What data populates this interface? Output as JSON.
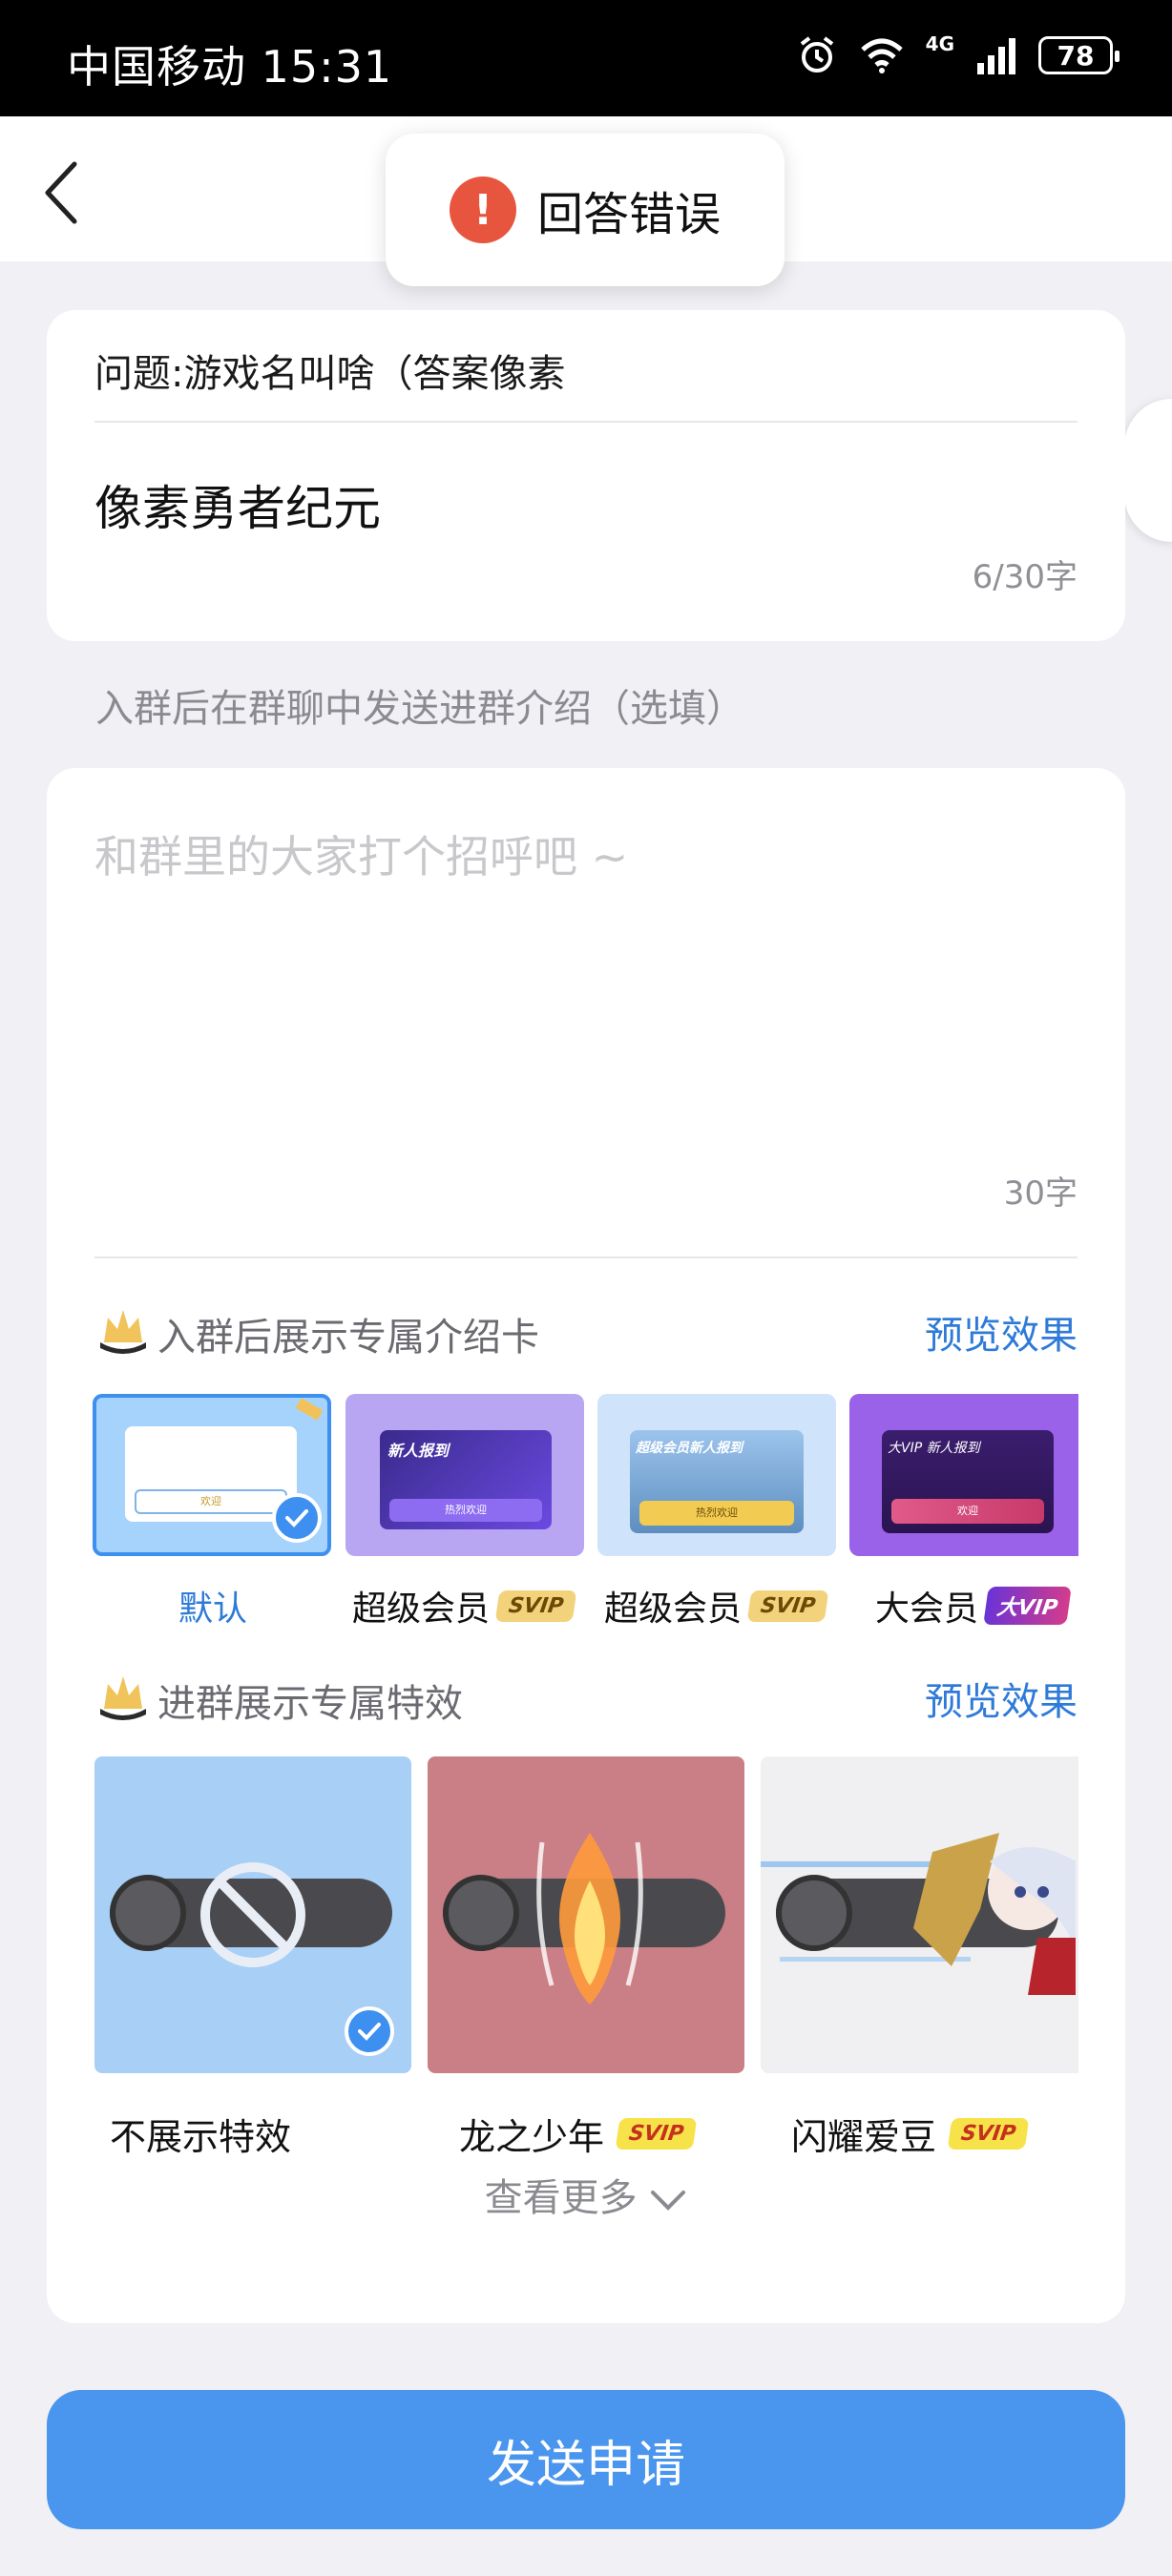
{
  "status_bar": {
    "carrier": "中国移动",
    "time": "15:31",
    "network": "4G",
    "battery": "78"
  },
  "toast": {
    "icon": "exclamation-icon",
    "icon_glyph": "!",
    "message": "回答错误"
  },
  "question": {
    "label": "问题:游戏名叫啥（答案像素",
    "answer": "像素勇者纪元",
    "counter": "6/30字"
  },
  "intro": {
    "hint": "入群后在群聊中发送进群介绍（选填）",
    "placeholder": "和群里的大家打个招呼吧 ~",
    "counter": "30字"
  },
  "intro_card_section": {
    "title": "入群后展示专属介绍卡",
    "preview": "预览效果",
    "options": [
      {
        "label": "默认",
        "badge": "",
        "selected": true
      },
      {
        "label": "超级会员",
        "badge": "SVIP",
        "selected": false
      },
      {
        "label": "超级会员",
        "badge": "SVIP",
        "selected": false
      },
      {
        "label": "大会员",
        "badge": "大VIP",
        "selected": false
      }
    ],
    "thumb_texts": {
      "default_button": "欢迎",
      "svip1_title": "新人报到",
      "svip1_button": "热烈欢迎",
      "svip2_title": "超级会员新人报到",
      "svip2_button": "热烈欢迎",
      "bigvip_title": "大VIP 新人报到",
      "bigvip_button": "欢迎"
    }
  },
  "effect_section": {
    "title": "进群展示专属特效",
    "preview": "预览效果",
    "options": [
      {
        "label": "不展示特效",
        "badge": "",
        "selected": true
      },
      {
        "label": "龙之少年",
        "badge": "SVIP",
        "selected": false
      },
      {
        "label": "闪耀爱豆",
        "badge": "SVIP",
        "selected": false
      }
    ],
    "more": "查看更多"
  },
  "submit": {
    "label": "发送申请"
  },
  "colors": {
    "accent": "#4a95ee",
    "link": "#2e7ad8",
    "error": "#e8553f",
    "background": "#f1f1f5"
  }
}
